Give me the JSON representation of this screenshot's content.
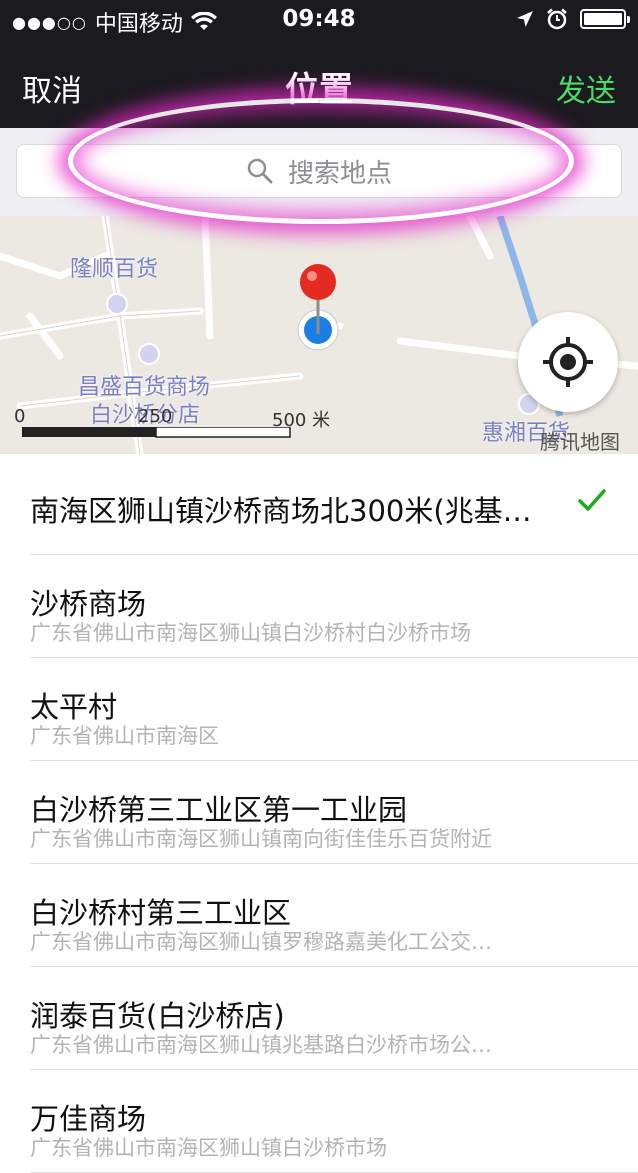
{
  "status_bar": {
    "signal_dots": "●●●○○",
    "carrier": "中国移动",
    "time": "09:48"
  },
  "nav": {
    "cancel": "取消",
    "title": "位置",
    "send": "发送",
    "send_color": "#4cd964"
  },
  "search": {
    "placeholder": "搜索地点"
  },
  "map": {
    "pois": [
      {
        "name": "隆顺百货"
      },
      {
        "name": "昌盛百货商场"
      },
      {
        "name": "白沙桥分店"
      },
      {
        "name": "惠湘百货"
      }
    ],
    "scale": {
      "zero": "0",
      "mid": "250",
      "end": "500 米"
    },
    "watermark": "腾讯地图"
  },
  "list": [
    {
      "title": "南海区狮山镇沙桥商场北300米(兆基…",
      "subtitle": "",
      "selected": true
    },
    {
      "title": "沙桥商场",
      "subtitle": "广东省佛山市南海区狮山镇白沙桥村白沙桥市场"
    },
    {
      "title": "太平村",
      "subtitle": "广东省佛山市南海区"
    },
    {
      "title": "白沙桥第三工业区第一工业园",
      "subtitle": "广东省佛山市南海区狮山镇南向街佳佳乐百货附近"
    },
    {
      "title": "白沙桥村第三工业区",
      "subtitle": "广东省佛山市南海区狮山镇罗穆路嘉美化工公交…"
    },
    {
      "title": "润泰百货(白沙桥店)",
      "subtitle": "广东省佛山市南海区狮山镇兆基路白沙桥市场公…"
    },
    {
      "title": "万佳商场",
      "subtitle": "广东省佛山市南海区狮山镇白沙桥市场"
    }
  ]
}
